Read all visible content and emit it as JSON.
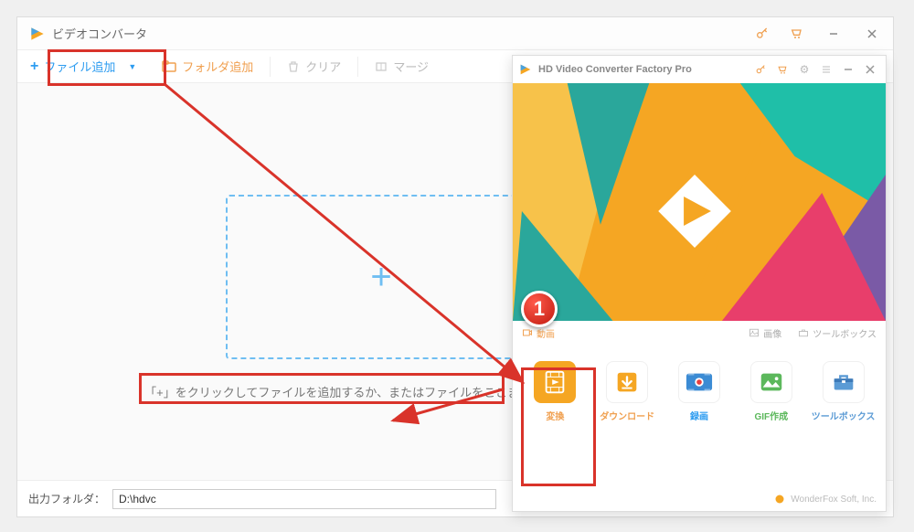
{
  "main": {
    "title": "ビデオコンバータ",
    "toolbar": {
      "add_file": "ファイル追加",
      "add_folder": "フォルダ追加",
      "clear": "クリア",
      "merge": "マージ"
    },
    "drop_hint": "「+」をクリックしてファイルを追加するか、またはファイルをここまでドラッグします。",
    "output_label": "出力フォルダ：",
    "output_path": "D:\\hdvc"
  },
  "sub": {
    "title": "HD Video Converter Factory Pro",
    "categories": {
      "video": "動画",
      "image": "画像",
      "toolbox": "ツールボックス"
    },
    "tiles": {
      "convert": "変換",
      "download": "ダウンロード",
      "record": "録画",
      "gif": "GIF作成",
      "toolbox": "ツールボックス"
    },
    "footer": "WonderFox Soft, Inc."
  },
  "annotations": {
    "badge1": "1"
  }
}
